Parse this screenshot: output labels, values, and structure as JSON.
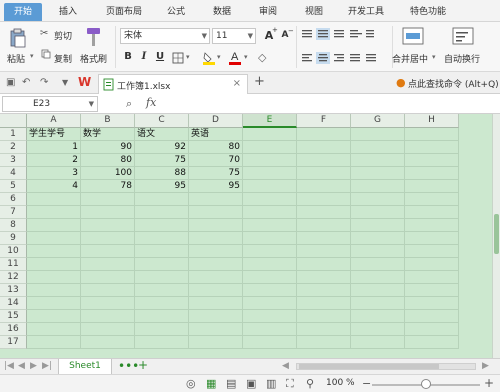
{
  "menubar": {
    "items": [
      "开始",
      "插入",
      "页面布局",
      "公式",
      "数据",
      "审阅",
      "视图",
      "开发工具",
      "特色功能"
    ]
  },
  "ribbon": {
    "paste": "粘贴",
    "cut": "剪切",
    "copy": "复制",
    "format_painter": "格式刷",
    "font_name": "宋体",
    "font_size": "11",
    "bold": "B",
    "italic": "I",
    "underline": "U",
    "font_grow": "A",
    "font_shrink": "A",
    "merge_center": "合并居中",
    "wrap_text": "自动换行"
  },
  "quickbar": {
    "doc_name": "工作簿1.xlsx",
    "add_tab": "+",
    "search_command": "点此查找命令 (Alt+Q)"
  },
  "formula_bar": {
    "name_box": "E23",
    "fx": "fx",
    "content": ""
  },
  "grid": {
    "columns": [
      "A",
      "B",
      "C",
      "D",
      "E",
      "F",
      "G",
      "H"
    ],
    "selected_column": "E",
    "rows": [
      "1",
      "2",
      "3",
      "4",
      "5",
      "6",
      "7",
      "8",
      "9",
      "10",
      "11",
      "12",
      "13",
      "14",
      "15",
      "16",
      "17"
    ],
    "cells": [
      [
        "学生学号",
        "数学",
        "语文",
        "英语"
      ],
      [
        "1",
        "90",
        "92",
        "80"
      ],
      [
        "2",
        "80",
        "75",
        "70"
      ],
      [
        "3",
        "100",
        "88",
        "75"
      ],
      [
        "4",
        "78",
        "95",
        "95"
      ]
    ]
  },
  "sheets": {
    "active": "Sheet1",
    "add": "+"
  },
  "statusbar": {
    "zoom": "100 %",
    "zoom_level": 1.0
  },
  "colors": {
    "accent": "#5b9bd5",
    "grid_bg": "#cce8cf",
    "selected_col": "#2a8a2a",
    "wps_red": "#d9352b"
  }
}
